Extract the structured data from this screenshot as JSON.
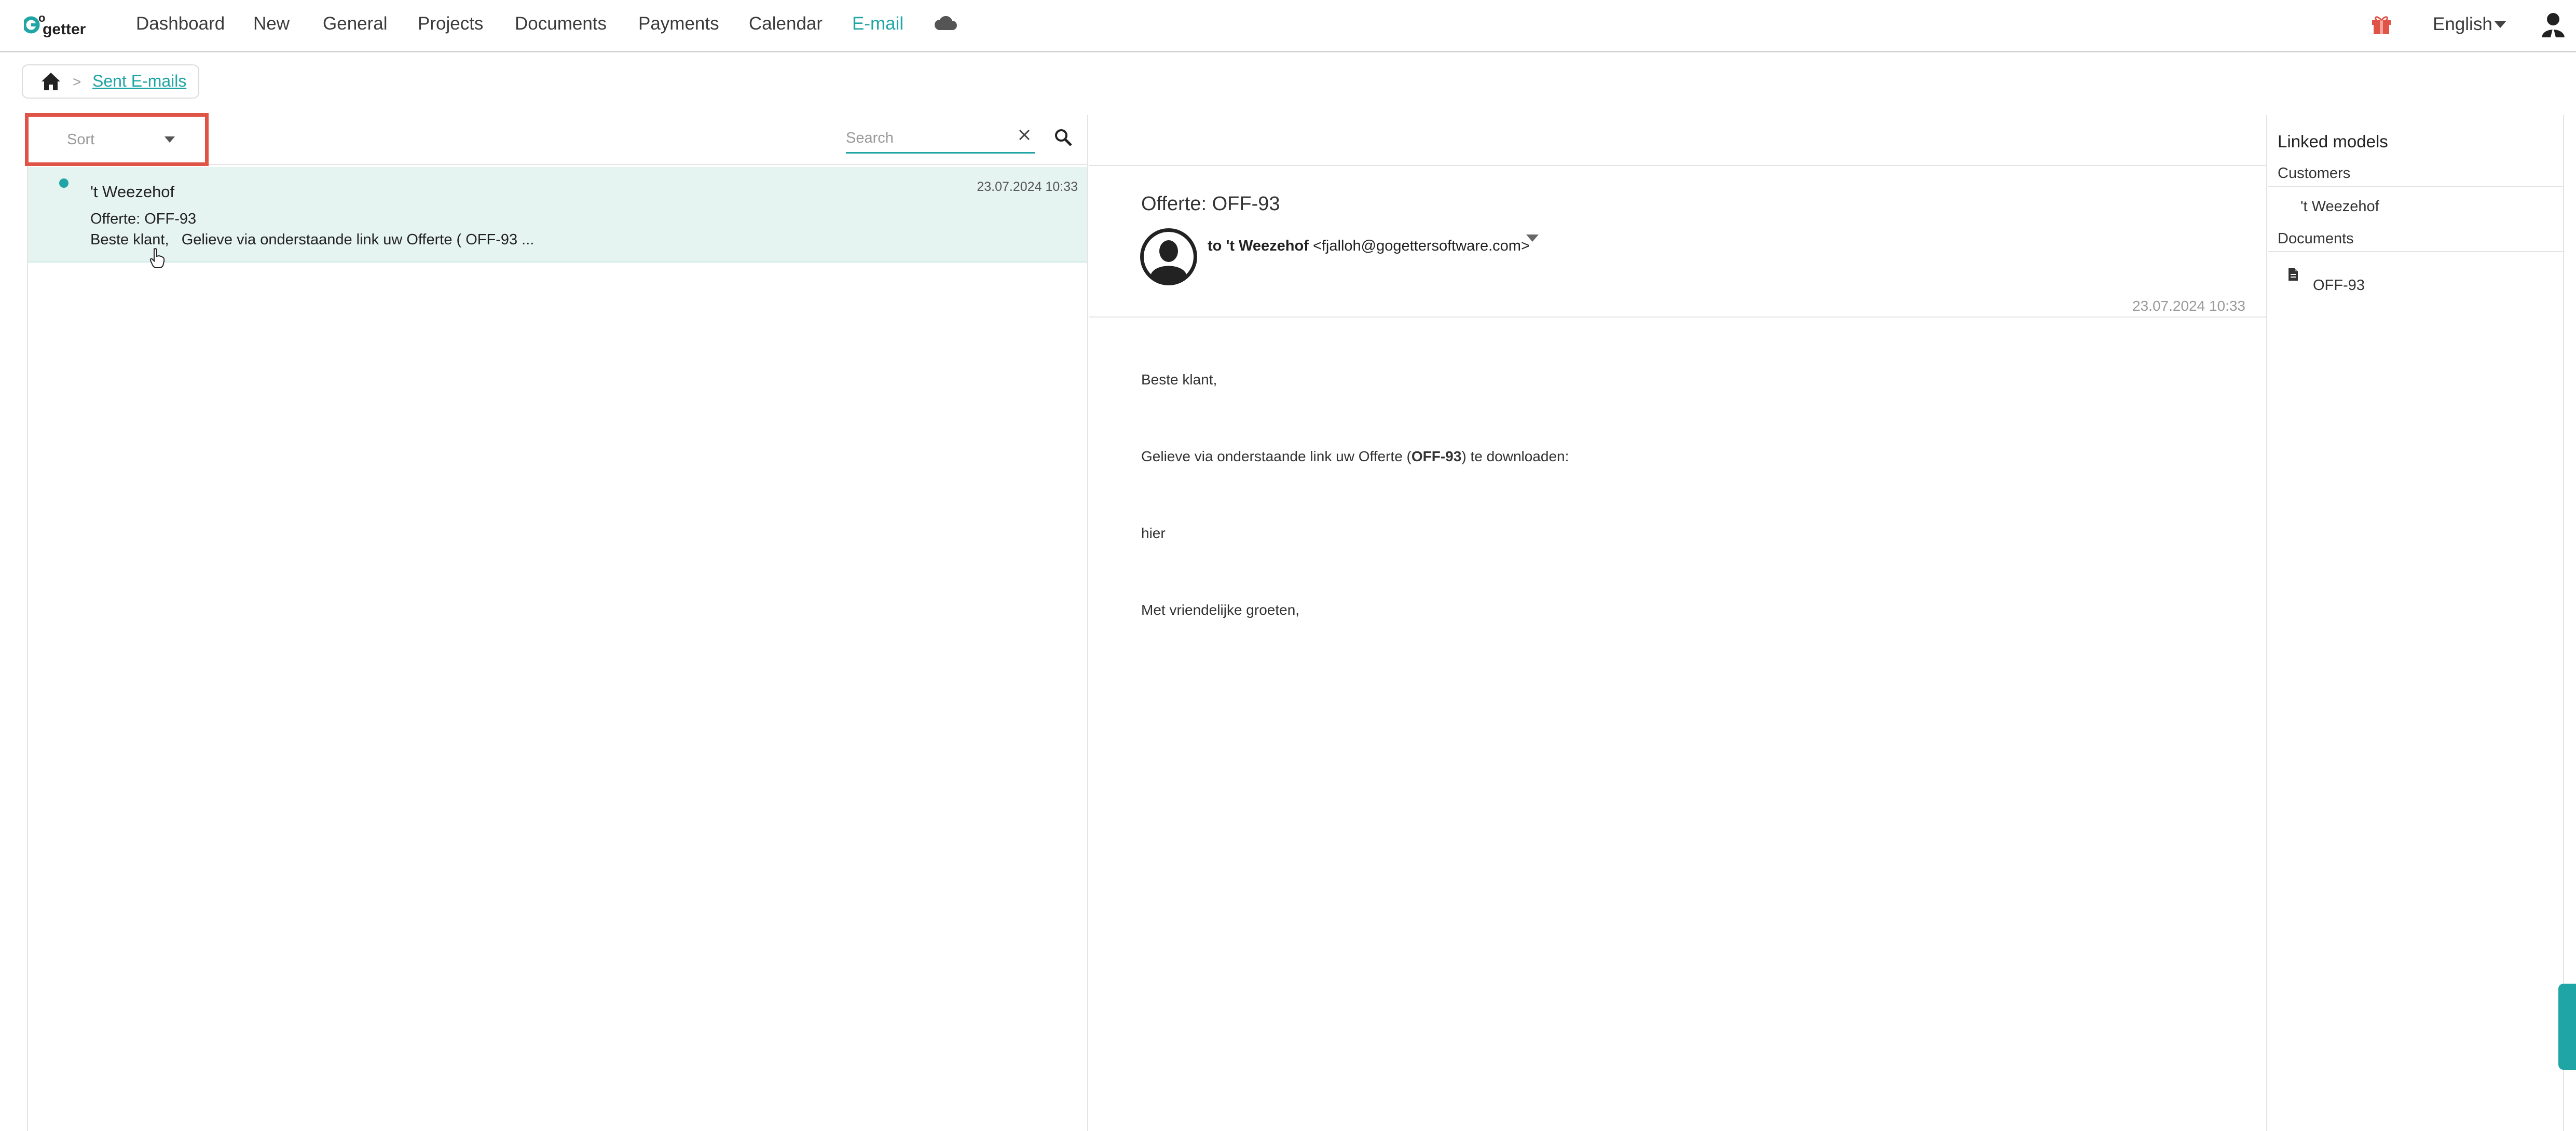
{
  "nav": {
    "logo_text": "GoGetter",
    "items": [
      {
        "label": "Dashboard"
      },
      {
        "label": "New"
      },
      {
        "label": "General"
      },
      {
        "label": "Projects"
      },
      {
        "label": "Documents"
      },
      {
        "label": "Payments"
      },
      {
        "label": "Calendar"
      },
      {
        "label": "E-mail",
        "active": true
      }
    ],
    "cloud_icon": "cloud-icon",
    "gift_icon": "gift-icon",
    "language": "English",
    "user_icon": "user-icon",
    "accent_color": "#1fa5a5"
  },
  "breadcrumb": {
    "home_icon": "home-icon",
    "separator": ">",
    "current": "Sent E-mails"
  },
  "list": {
    "sort_label": "Sort",
    "search_placeholder": "Search",
    "clear_icon": "close-icon",
    "search_icon": "search-icon",
    "highlight_color": "#e05448",
    "emails": [
      {
        "sender": "'t Weezehof",
        "date": "23.07.2024 10:33",
        "subject": "Offerte: OFF-93",
        "preview": "Beste klant,   Gelieve via onderstaande link uw Offerte ( OFF-93 ...",
        "unread": true
      }
    ]
  },
  "message": {
    "subject": "Offerte: OFF-93",
    "to_prefix": "to",
    "to_name": "'t Weezehof",
    "to_email": "<fjalloh@gogettersoftware.com>",
    "date": "23.07.2024 10:33",
    "body": {
      "greeting": "Beste klant,",
      "line1_before": "Gelieve via onderstaande link uw Offerte (",
      "line1_bold": "OFF-93",
      "line1_after": ") te downloaden:",
      "link": "hier",
      "closing": "Met vriendelijke groeten,"
    }
  },
  "linked": {
    "title": "Linked models",
    "customers_label": "Customers",
    "customers": [
      "'t Weezehof"
    ],
    "documents_label": "Documents",
    "documents": [
      "OFF-93"
    ],
    "document_icon": "document-icon"
  }
}
